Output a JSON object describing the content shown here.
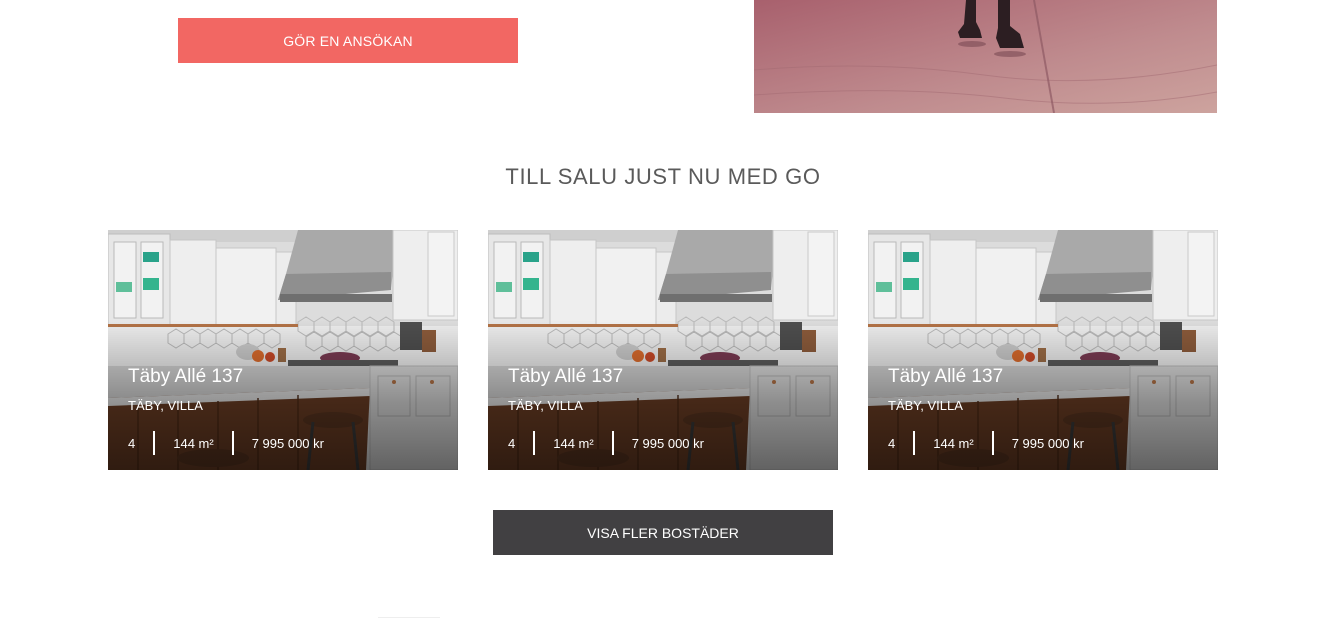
{
  "apply_button": {
    "label": "GÖR EN ANSÖKAN"
  },
  "section": {
    "title": "TILL SALU JUST NU MED GO"
  },
  "listings": [
    {
      "address": "Täby Allé 137",
      "location": "TÄBY, VILLA",
      "rooms": "4",
      "area": "144 m²",
      "price": "7 995 000 kr"
    },
    {
      "address": "Täby Allé 137",
      "location": "TÄBY, VILLA",
      "rooms": "4",
      "area": "144 m²",
      "price": "7 995 000 kr"
    },
    {
      "address": "Täby Allé 137",
      "location": "TÄBY, VILLA",
      "rooms": "4",
      "area": "144 m²",
      "price": "7 995 000 kr"
    }
  ],
  "more_button": {
    "label": "VISA FLER BOSTÄDER"
  },
  "colors": {
    "accent": "#f26763",
    "dark_button": "#414042",
    "title_text": "#5a5a5a"
  },
  "images": {
    "hero": "street-photo-pink-tint",
    "listing": "kitchen-photo"
  }
}
